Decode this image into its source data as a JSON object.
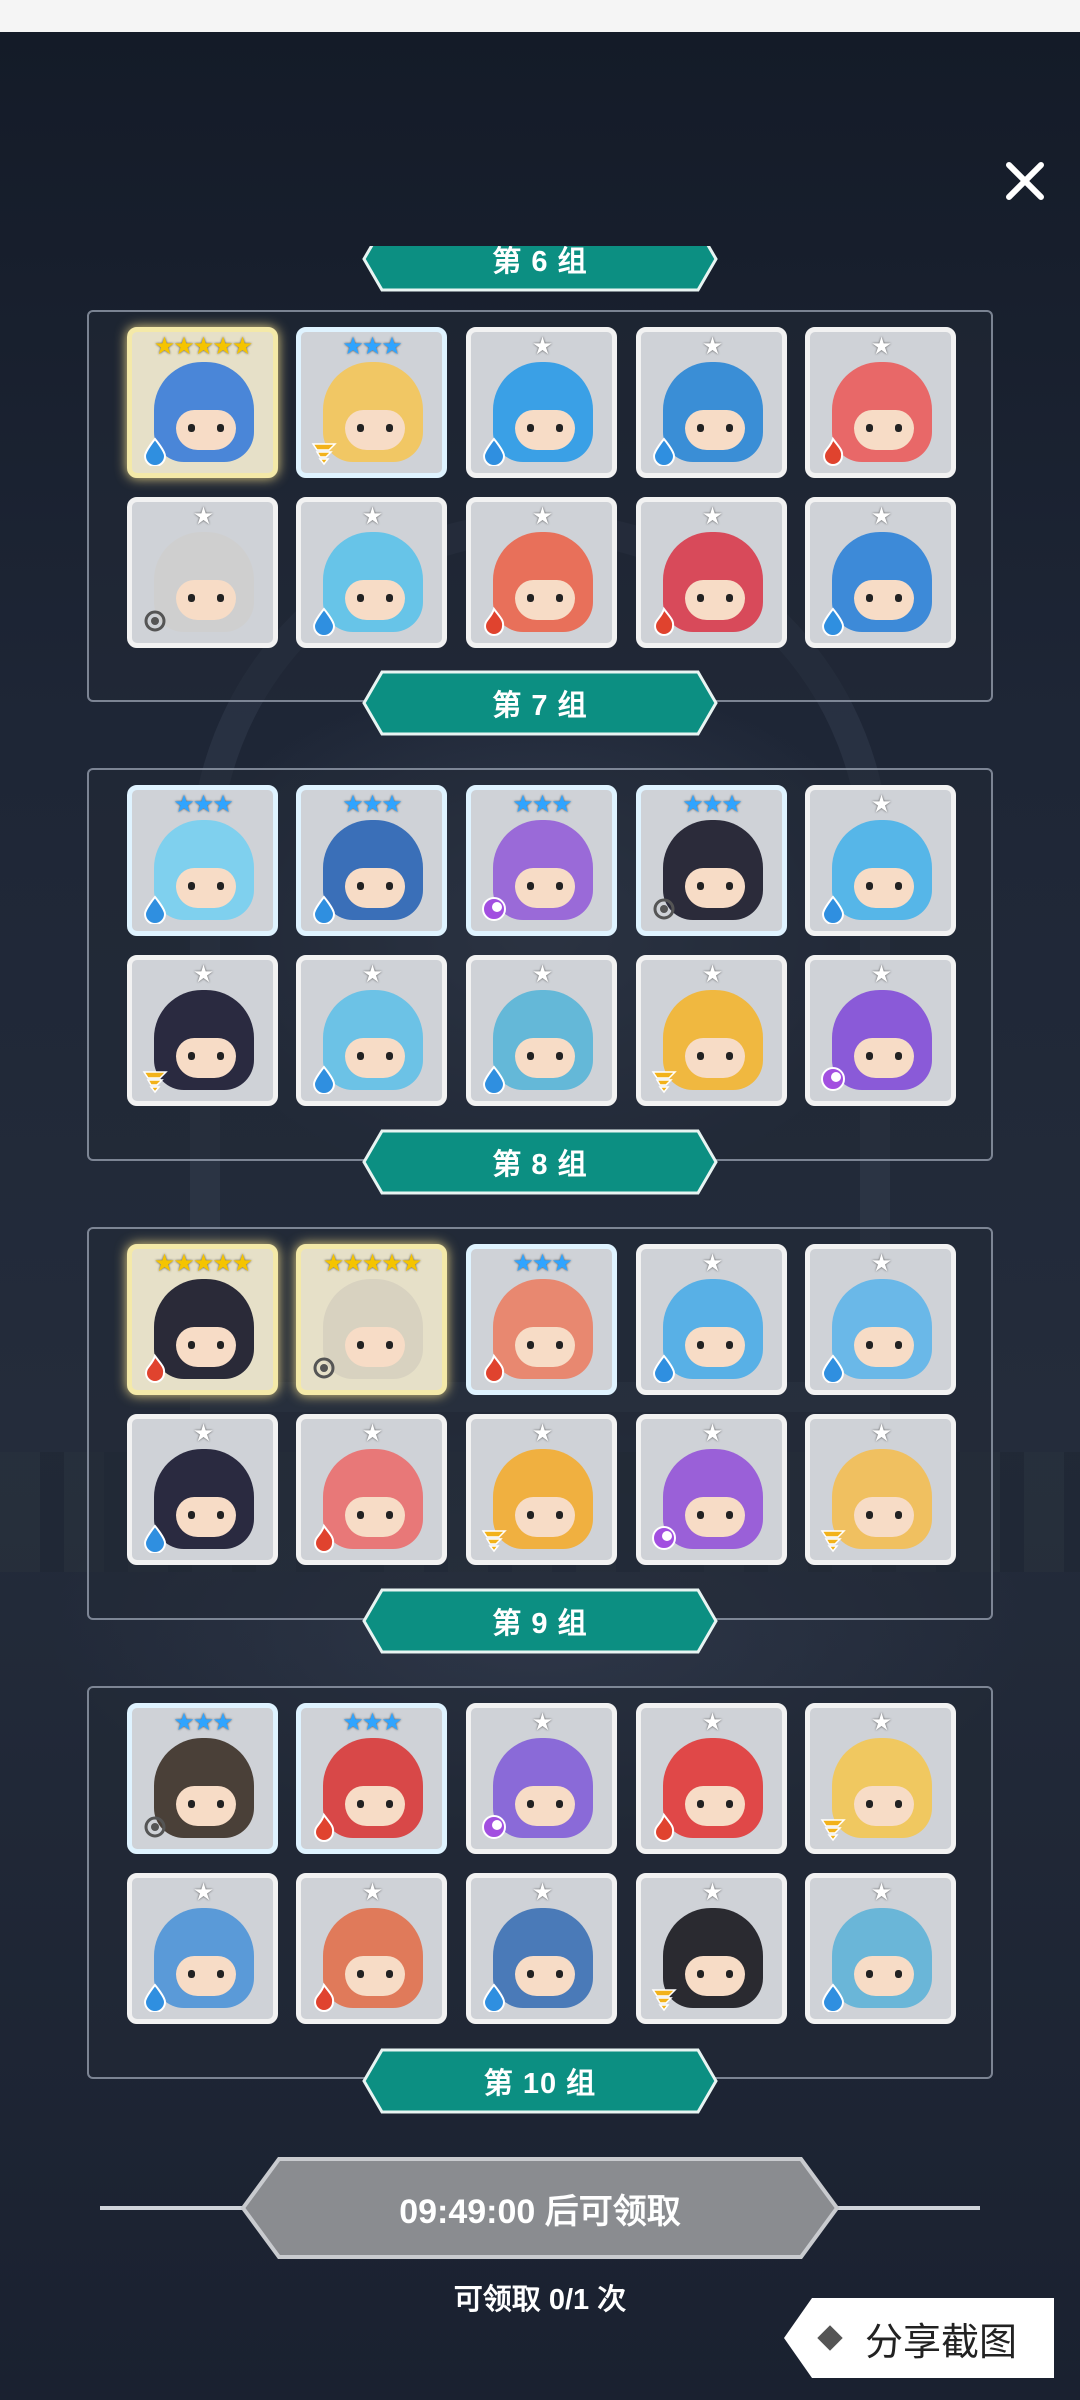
{
  "close_label": "×",
  "groups": [
    {
      "label": "第 6 组"
    },
    {
      "label": "第 7 组"
    },
    {
      "label": "第 8 组"
    },
    {
      "label": "第 9 组"
    },
    {
      "label": "第 10 组"
    }
  ],
  "panels": [
    {
      "ribbon_label": "第 7 组",
      "heroes": [
        {
          "stars": "★★★★★",
          "color": "#4a86d8",
          "element": "water",
          "gold": true
        },
        {
          "stars": "★★★",
          "color": "#f1c764",
          "element": "wind",
          "blue": true
        },
        {
          "stars": "★",
          "color": "#3aa0e6",
          "element": "water"
        },
        {
          "stars": "★",
          "color": "#3a8ed6",
          "element": "water"
        },
        {
          "stars": "★",
          "color": "#e86868",
          "element": "fire"
        },
        {
          "stars": "★",
          "color": "#cfcfcf",
          "element": "light"
        },
        {
          "stars": "★",
          "color": "#67c4e8",
          "element": "water"
        },
        {
          "stars": "★",
          "color": "#e8705a",
          "element": "fire"
        },
        {
          "stars": "★",
          "color": "#d84a5a",
          "element": "fire"
        },
        {
          "stars": "★",
          "color": "#3d8ad8",
          "element": "water"
        }
      ]
    },
    {
      "ribbon_label": "第 8 组",
      "heroes": [
        {
          "stars": "★★★",
          "color": "#7fd0ee",
          "element": "water",
          "blue": true
        },
        {
          "stars": "★★★",
          "color": "#3a6fb8",
          "element": "water",
          "blue": true
        },
        {
          "stars": "★★★",
          "color": "#9a6ad8",
          "element": "dark",
          "blue": true
        },
        {
          "stars": "★★★",
          "color": "#2b2b3a",
          "element": "light",
          "blue": true
        },
        {
          "stars": "★",
          "color": "#56b6e8",
          "element": "water"
        },
        {
          "stars": "★",
          "color": "#2a2a40",
          "element": "wind"
        },
        {
          "stars": "★",
          "color": "#6cc2e6",
          "element": "water"
        },
        {
          "stars": "★",
          "color": "#64b8d8",
          "element": "water"
        },
        {
          "stars": "★",
          "color": "#f0b840",
          "element": "wind"
        },
        {
          "stars": "★",
          "color": "#8a5ad8",
          "element": "dark"
        }
      ]
    },
    {
      "ribbon_label": "第 9 组",
      "heroes": [
        {
          "stars": "★★★★★",
          "color": "#2a2a38",
          "element": "fire",
          "gold": true
        },
        {
          "stars": "★★★★★",
          "color": "#d8d2c0",
          "element": "light",
          "gold": true
        },
        {
          "stars": "★★★",
          "color": "#e88870",
          "element": "fire",
          "blue": true
        },
        {
          "stars": "★",
          "color": "#58b0e6",
          "element": "water"
        },
        {
          "stars": "★",
          "color": "#6ab8e8",
          "element": "water"
        },
        {
          "stars": "★",
          "color": "#2a2a40",
          "element": "water"
        },
        {
          "stars": "★",
          "color": "#e87878",
          "element": "fire"
        },
        {
          "stars": "★",
          "color": "#f0b040",
          "element": "wind"
        },
        {
          "stars": "★",
          "color": "#9a60d8",
          "element": "dark"
        },
        {
          "stars": "★",
          "color": "#f0c060",
          "element": "wind"
        }
      ]
    },
    {
      "ribbon_label": "第 10 组",
      "heroes": [
        {
          "stars": "★★★",
          "color": "#4a4038",
          "element": "light",
          "blue": true
        },
        {
          "stars": "★★★",
          "color": "#d84848",
          "element": "fire",
          "blue": true
        },
        {
          "stars": "★",
          "color": "#8a6ad8",
          "element": "dark"
        },
        {
          "stars": "★",
          "color": "#e04848",
          "element": "fire"
        },
        {
          "stars": "★",
          "color": "#f0c860",
          "element": "wind"
        },
        {
          "stars": "★",
          "color": "#5a9ad8",
          "element": "water"
        },
        {
          "stars": "★",
          "color": "#e07a5a",
          "element": "fire"
        },
        {
          "stars": "★",
          "color": "#4a7ab8",
          "element": "water"
        },
        {
          "stars": "★",
          "color": "#2a2a30",
          "element": "wind"
        },
        {
          "stars": "★",
          "color": "#6ab6d8",
          "element": "water"
        }
      ]
    }
  ],
  "element_colors": {
    "water": "#2f8fe0",
    "fire": "#e0432e",
    "wind": "#f2b21a",
    "light": "#ffffff",
    "dark": "#a24fe0"
  },
  "claim": {
    "timer_label": "09:49:00 后可领取",
    "count_label": "可领取 0/1 次"
  },
  "share_label": "分享截图"
}
